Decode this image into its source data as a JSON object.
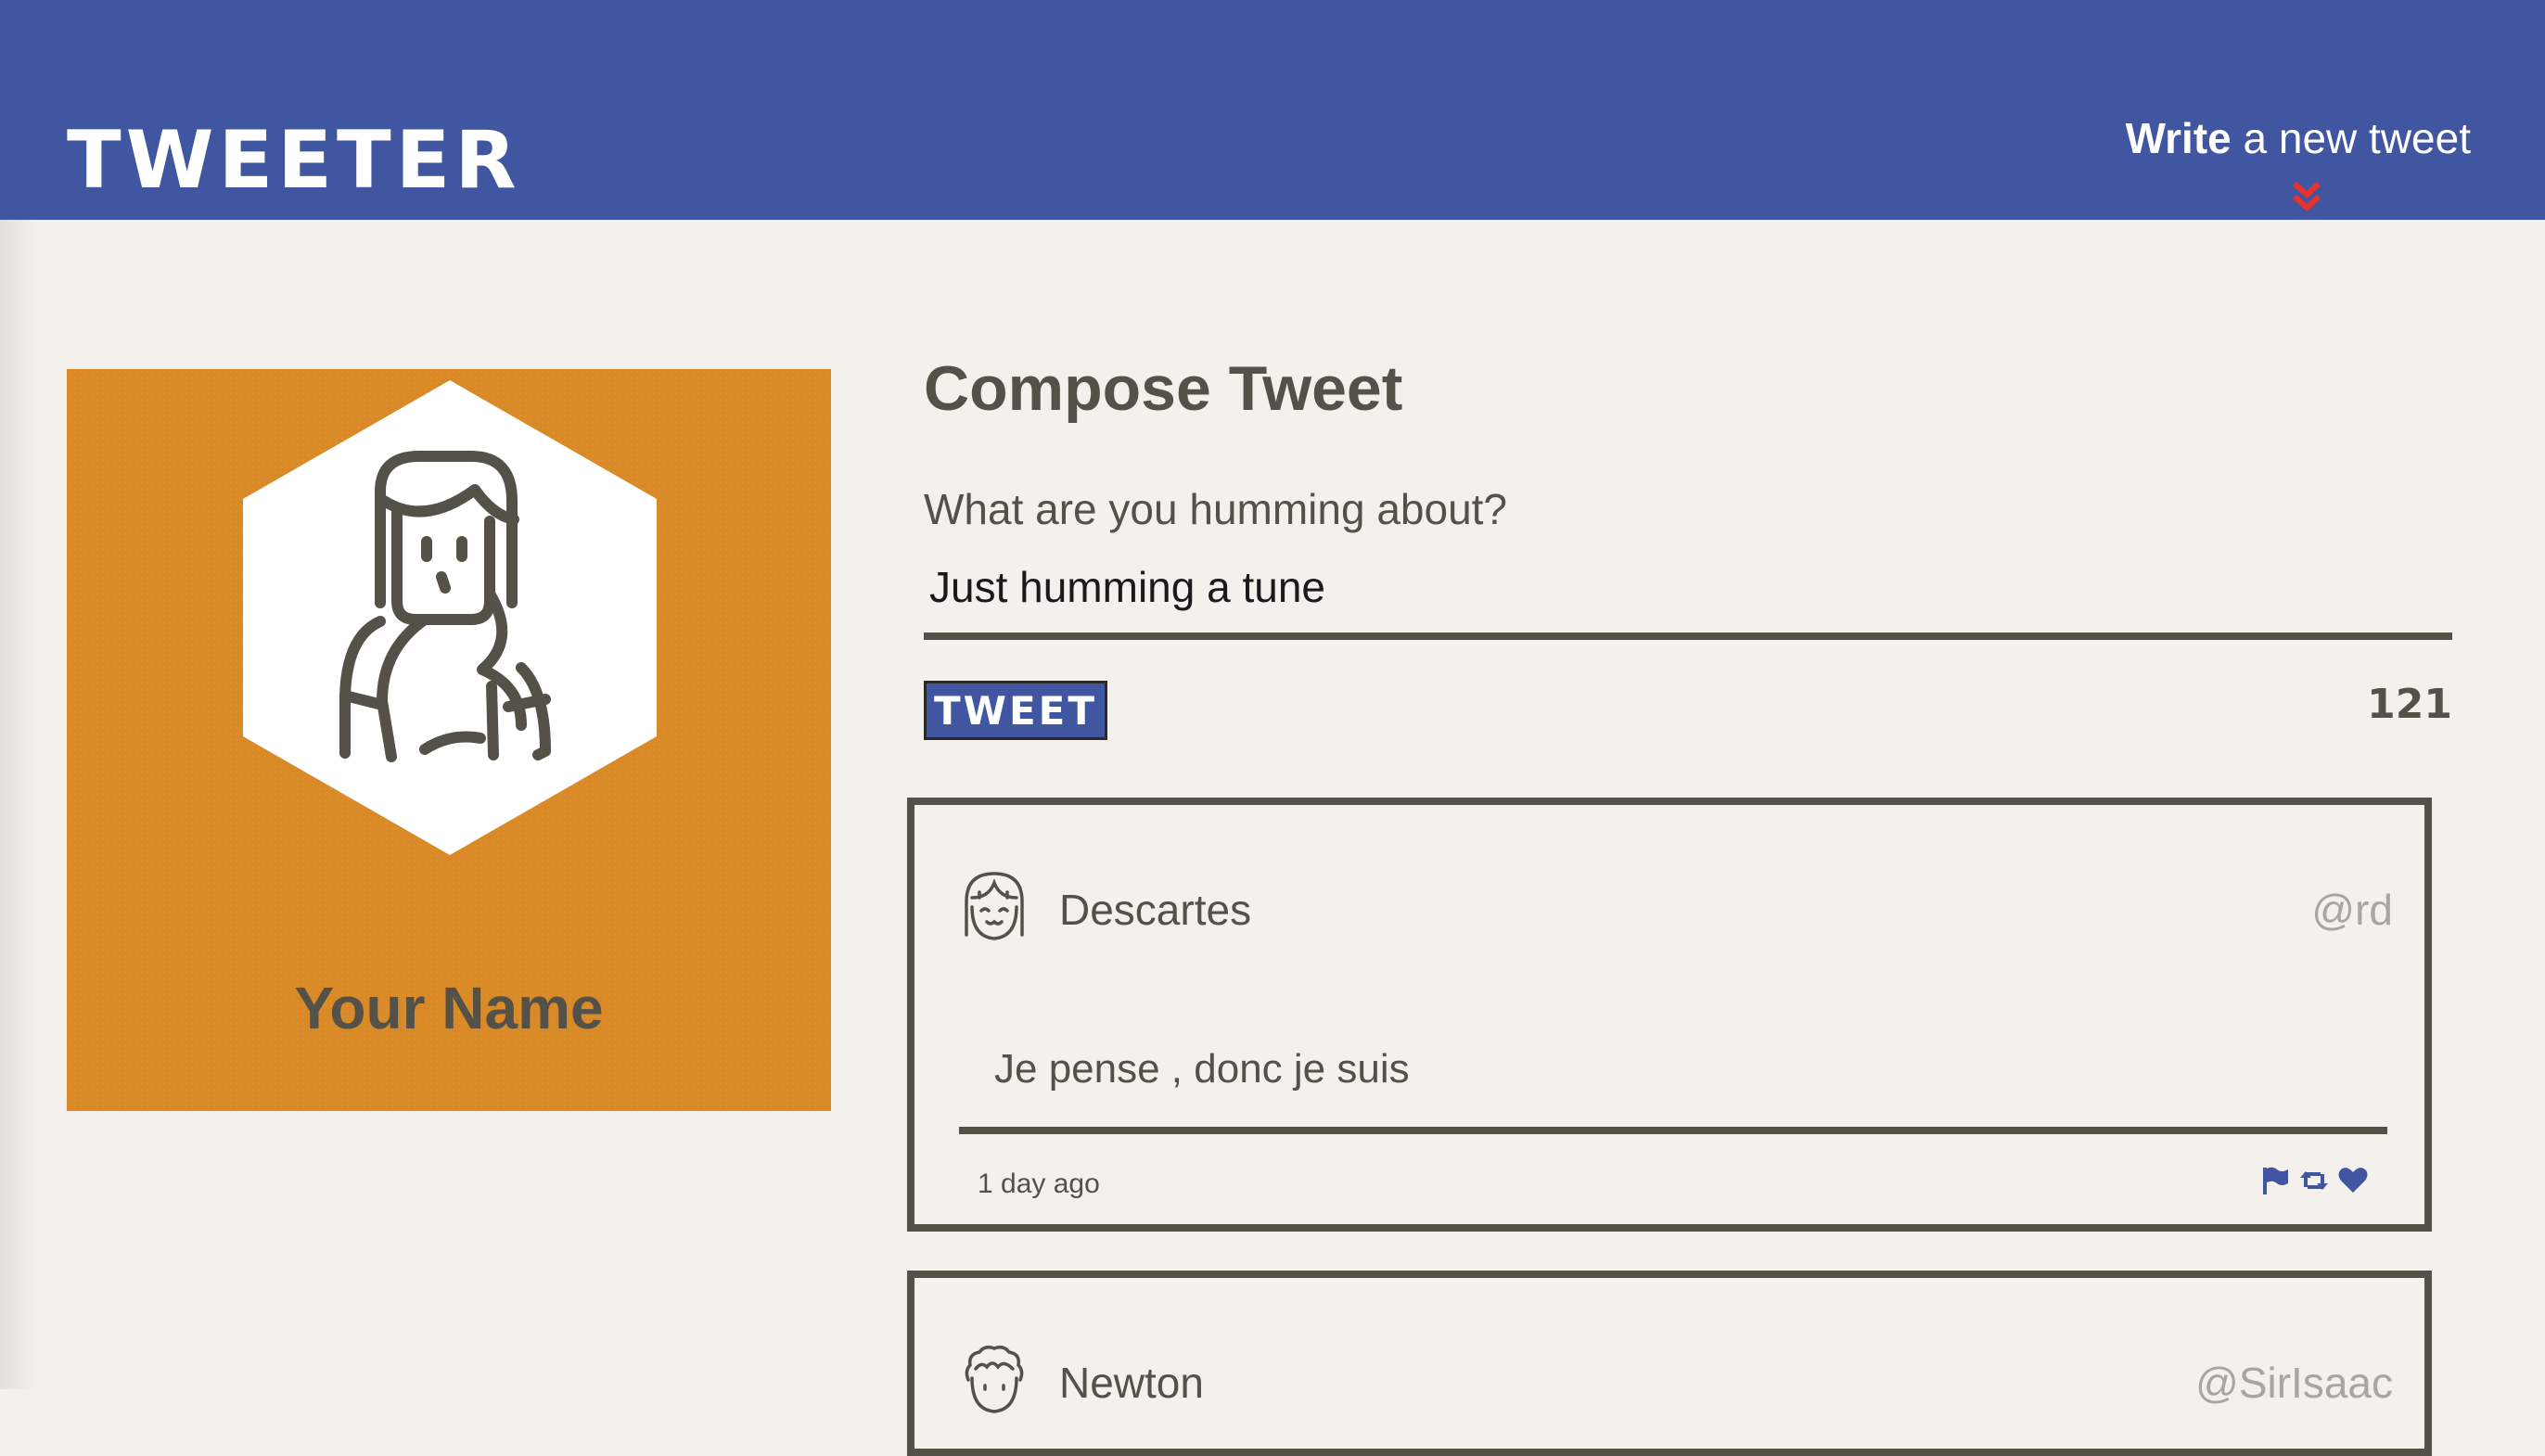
{
  "header": {
    "brand": "TWEETER",
    "nav_compose_bold": "Write",
    "nav_compose_rest": " a new tweet",
    "icons": {
      "nav_chevron": "chevron-double-down-icon"
    },
    "colors": {
      "bar": "#4056a1",
      "chevron": "#e8322c"
    }
  },
  "profile": {
    "name": "Your Name",
    "avatar_icon": "woman-avatar-icon",
    "card_color": "#d98a26"
  },
  "compose": {
    "title": "Compose Tweet",
    "prompt_label": "What are you humming about?",
    "input_value": "Just humming a tune",
    "button_label": "TWEET",
    "char_count": "121"
  },
  "tweets": [
    {
      "author": "Descartes",
      "handle": "@rd",
      "text": "Je pense , donc je suis",
      "time": "1 day ago",
      "avatar_icon": "smiling-face-avatar-icon",
      "actions": [
        "flag-icon",
        "retweet-icon",
        "heart-icon"
      ]
    },
    {
      "author": "Newton",
      "handle": "@SirIsaac",
      "avatar_icon": "curly-hair-avatar-icon"
    }
  ]
}
